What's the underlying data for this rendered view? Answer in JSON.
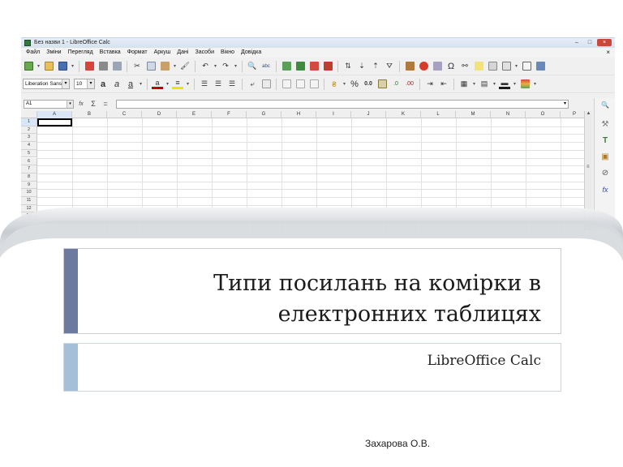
{
  "window": {
    "title": "Без назви 1 - LibreOffice Calc",
    "controls": [
      "–",
      "□",
      "×"
    ]
  },
  "menu": {
    "items": [
      "Файл",
      "Зміни",
      "Перегляд",
      "Вставка",
      "Формат",
      "Аркуш",
      "Дані",
      "Засоби",
      "Вікно",
      "Довідка"
    ],
    "close": "×"
  },
  "format_toolbar": {
    "font_name": "Liberation Sans",
    "font_size": "10",
    "bold": "a",
    "italic": "a",
    "underline": "a",
    "percent": "%",
    "decimal": "0.0"
  },
  "formula_bar": {
    "cell_ref": "A1",
    "sum_symbol": "Σ",
    "equals_symbol": "="
  },
  "sheet": {
    "columns": [
      "A",
      "B",
      "C",
      "D",
      "E",
      "F",
      "G",
      "H",
      "I",
      "J",
      "K",
      "L",
      "M",
      "N",
      "O",
      "P"
    ],
    "rows": [
      "1",
      "2",
      "3",
      "4",
      "5",
      "6",
      "7",
      "8",
      "9",
      "10",
      "11",
      "12",
      "13"
    ]
  },
  "icons": {
    "special_char": "Ω",
    "sidebar": [
      "search-icon",
      "wrench-icon",
      "text-icon",
      "gallery-icon",
      "navigator-icon",
      "functions-icon"
    ]
  },
  "colors": {
    "title_accent": "#6c7aa0",
    "subtitle_accent": "#a5bfd8",
    "swoosh": "#bfc3c8"
  },
  "slide": {
    "title": "Типи посилань на комірки в електронних таблицях",
    "subtitle": "LibreOffice Calc",
    "author": "Захарова О.В."
  }
}
